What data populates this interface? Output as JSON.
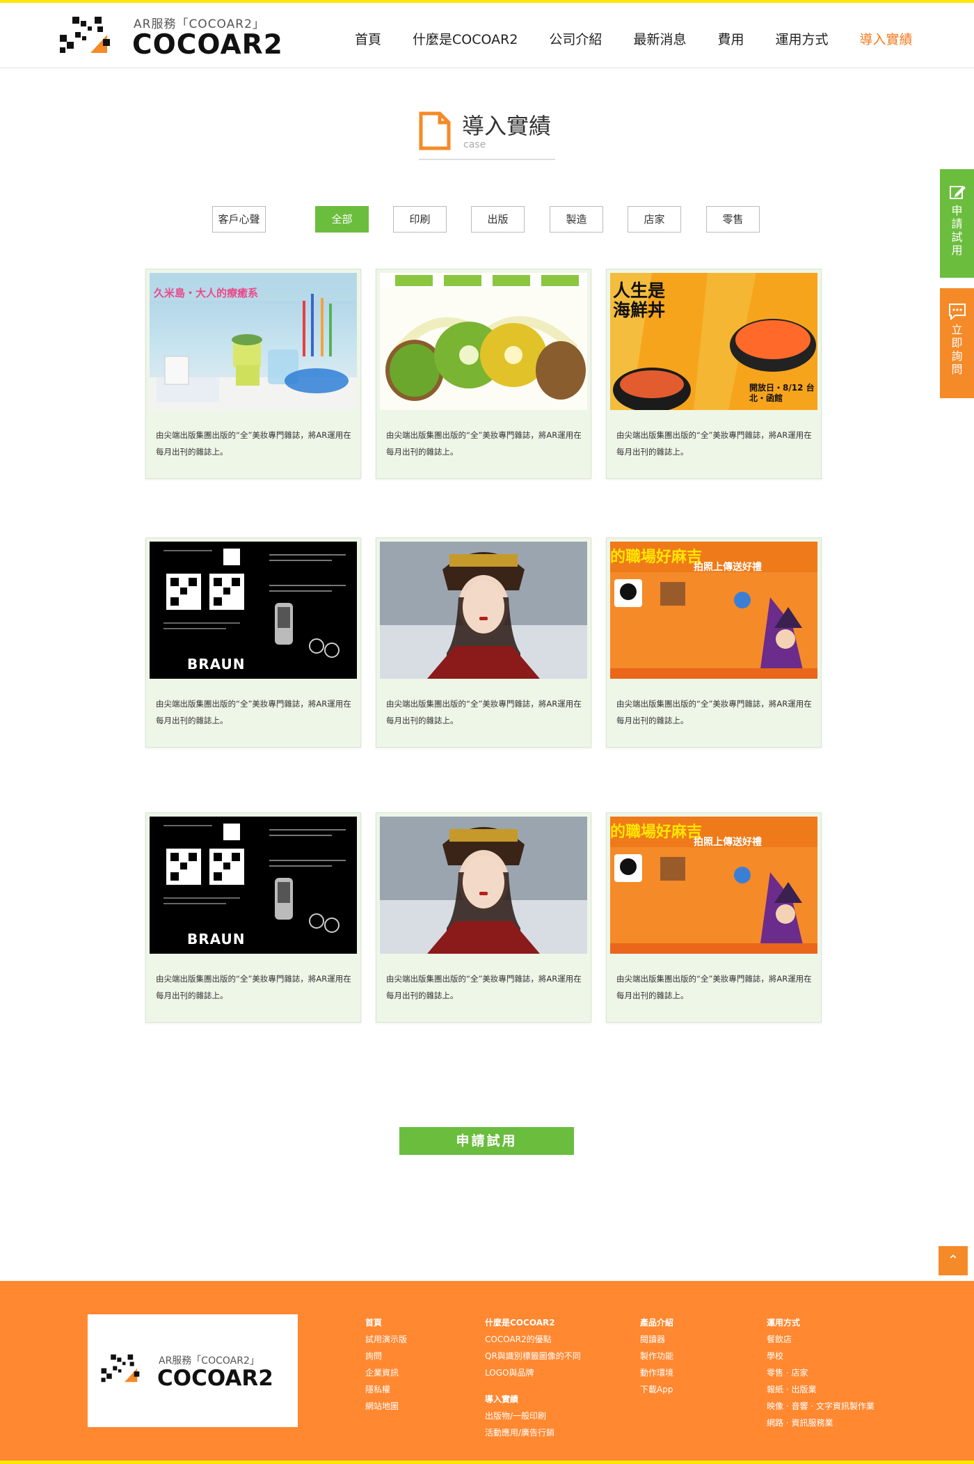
{
  "header": {
    "logo_tagline": "AR服務「COCOAR2」",
    "logo_name": "COCOAR2",
    "nav": [
      {
        "label": "首頁"
      },
      {
        "label": "什麼是COCOAR2"
      },
      {
        "label": "公司介紹"
      },
      {
        "label": "最新消息"
      },
      {
        "label": "費用"
      },
      {
        "label": "運用方式"
      },
      {
        "label": "導入實績"
      }
    ]
  },
  "section": {
    "title": "導入實績",
    "subtitle": "case"
  },
  "filters": [
    {
      "label": "客戶心聲",
      "active": false
    },
    {
      "label": "全部",
      "active": true
    },
    {
      "label": "印刷",
      "active": false
    },
    {
      "label": "出版",
      "active": false
    },
    {
      "label": "製造",
      "active": false
    },
    {
      "label": "店家",
      "active": false
    },
    {
      "label": "零售",
      "active": false
    }
  ],
  "cases": [
    {
      "image": "stationery-desk-photo",
      "image_text": "久米島・大人的療癒系",
      "description": "由尖端出版集團出版的“全”美妝專門雜誌，將AR運用在每月出刊的雜誌上。"
    },
    {
      "image": "kiwi-fruit-photo",
      "image_text": "",
      "description": "由尖端出版集團出版的“全”美妝專門雜誌，將AR運用在每月出刊的雜誌上。"
    },
    {
      "image": "seafood-bowl-poster",
      "image_text": "人生是海鮮丼",
      "image_text2": "開放日・8/12 台北・函館",
      "description": "由尖端出版集團出版的“全”美妝專門雜誌，將AR運用在每月出刊的雜誌上。"
    },
    {
      "image": "braun-app-guide",
      "image_text": "BRAUN",
      "description": "由尖端出版集團出版的“全”美妝專門雜誌，將AR運用在每月出刊的雜誌上。"
    },
    {
      "image": "period-drama-portrait",
      "image_text": "",
      "description": "由尖端出版集團出版的“全”美妝專門雜誌，將AR運用在每月出刊的雜誌上。"
    },
    {
      "image": "job-halloween-poster",
      "image_text": "的職場好麻吉",
      "image_text2": "拍照上傳送好禮",
      "description": "由尖端出版集團出版的“全”美妝專門雜誌，將AR運用在每月出刊的雜誌上。"
    },
    {
      "image": "braun-app-guide",
      "image_text": "BRAUN",
      "description": "由尖端出版集團出版的“全”美妝專門雜誌，將AR運用在每月出刊的雜誌上。"
    },
    {
      "image": "period-drama-portrait",
      "image_text": "",
      "description": "由尖端出版集團出版的“全”美妝專門雜誌，將AR運用在每月出刊的雜誌上。"
    },
    {
      "image": "job-halloween-poster",
      "image_text": "的職場好麻吉",
      "image_text2": "拍照上傳送好禮",
      "description": "由尖端出版集團出版的“全”美妝專門雜誌，將AR運用在每月出刊的雜誌上。"
    }
  ],
  "apply_button": "申請試用",
  "side_tabs": {
    "trial": "申請試用",
    "inquiry": "立即詢問"
  },
  "to_top": "⌃",
  "footer": {
    "logo_tagline": "AR服務「COCOAR2」",
    "logo_name": "COCOAR2",
    "columns": [
      {
        "head": "首頁",
        "items": [
          "試用演示版",
          "詢問",
          "企業資訊",
          "隱私權",
          "網站地圖"
        ]
      },
      {
        "head": "什麼是COCOAR2",
        "items": [
          "COCOAR2的優點",
          "QR與識別標籤圖像的不同",
          "LOGO與品牌"
        ],
        "sub_head": "導入實績",
        "sub_items": [
          "出版物/一般印刷",
          "活動應用/廣告行銷"
        ]
      },
      {
        "head": "產品介紹",
        "items": [
          "閱讀器",
          "製作功能",
          "動作環境",
          "下載App"
        ]
      },
      {
        "head": "運用方式",
        "items": [
          "餐飲店",
          "學校",
          "零售 · 店家",
          "報紙 · 出版業",
          "映像 · 音響 · 文字資訊製作業",
          "網路 · 資訊服務業"
        ]
      }
    ]
  },
  "colors": {
    "accent_orange": "#f58a28",
    "accent_green": "#6bbd3e",
    "top_line": "#ffe600"
  }
}
